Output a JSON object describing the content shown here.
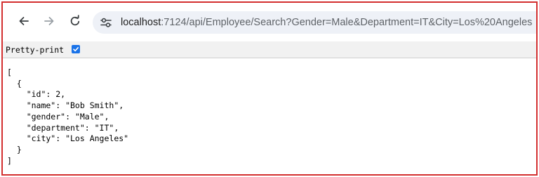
{
  "browser": {
    "url_host": "localhost",
    "url_rest": ":7124/api/Employee/Search?Gender=Male&Department=IT&City=Los%20Angeles",
    "back_icon": "arrow-left-icon",
    "forward_icon": "arrow-right-icon",
    "reload_icon": "reload-icon",
    "site_info_icon": "tune-icon"
  },
  "pretty_print": {
    "label": "Pretty-print",
    "checked": true,
    "check_color": "#1a73e8"
  },
  "json": {
    "open_bracket": "[",
    "open_brace": "  {",
    "lines": [
      "    \"id\": 2,",
      "    \"name\": \"Bob Smith\",",
      "    \"gender\": \"Male\",",
      "    \"department\": \"IT\",",
      "    \"city\": \"Los Angeles\""
    ],
    "close_brace": "  }",
    "close_bracket": "]"
  },
  "frame_color": "#d32f2f"
}
